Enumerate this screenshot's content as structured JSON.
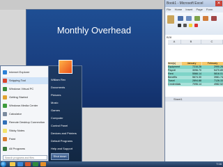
{
  "slide": {
    "title": "Monthly Overhead"
  },
  "excel": {
    "title": "Book1 - Microsoft Excel",
    "ribbon_tabs": [
      "File",
      "Home",
      "Insert",
      "Page",
      "Form"
    ],
    "name_box": "B28",
    "columns": [
      "A",
      "B",
      "C"
    ],
    "table": {
      "headers": [
        "Item(s)",
        "January",
        "February"
      ],
      "rows": [
        [
          "Equipment",
          "7216.28",
          "2990.26"
        ],
        [
          "Payroll",
          "3096.70",
          "5470.89"
        ],
        [
          "Rent",
          "5566.14",
          "5816.01"
        ],
        [
          "Benefits",
          "5674.30",
          "3981.74"
        ],
        [
          "Travel",
          "2894.88",
          "7126.33"
        ],
        [
          "Credentials",
          "7096.14",
          "4982.52"
        ]
      ]
    },
    "sheet_tab": "Sheet1"
  },
  "start_menu": {
    "left_items": [
      "Internet Explorer",
      "Snipping Tool",
      "Windows Virtual PC",
      "Getting Started",
      "Windows Media Center",
      "Calculator",
      "Remote Desktop Connection",
      "Sticky Notes",
      "Paint"
    ],
    "all_programs": "All Programs",
    "search_placeholder": "Search programs and files",
    "right_items": [
      "William Rex",
      "Documents",
      "Pictures",
      "Music",
      "Games",
      "Computer",
      "Control Panel",
      "Devices and Printers",
      "Default Programs",
      "Help and Support"
    ],
    "shutdown_label": "Shut down"
  },
  "taskbar": {
    "time": "7:16"
  }
}
